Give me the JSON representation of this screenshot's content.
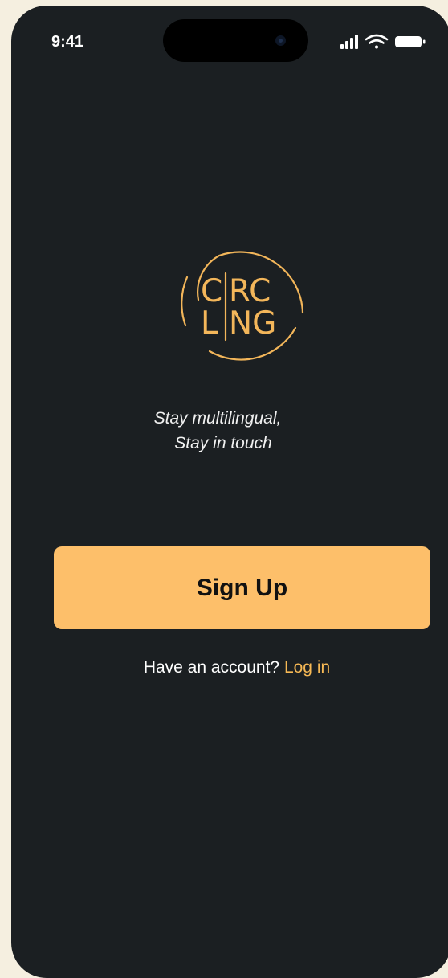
{
  "status_bar": {
    "time": "9:41",
    "icons": [
      "cellular-signal-icon",
      "wifi-icon",
      "battery-icon"
    ]
  },
  "logo": {
    "line1_left": "C",
    "line1_right": "RC",
    "line2_left": "L",
    "line2_right": "NG",
    "accent_color": "#f3b65a"
  },
  "tagline": {
    "line1": "Stay multilingual,",
    "line2": "Stay in touch"
  },
  "signup": {
    "label": "Sign Up",
    "color": "#fdbf6a"
  },
  "account": {
    "prompt": "Have an account?",
    "login_label": "Log in",
    "link_color": "#f7b955"
  },
  "colors": {
    "background": "#f5efe0",
    "screen": "#1b1f22"
  }
}
